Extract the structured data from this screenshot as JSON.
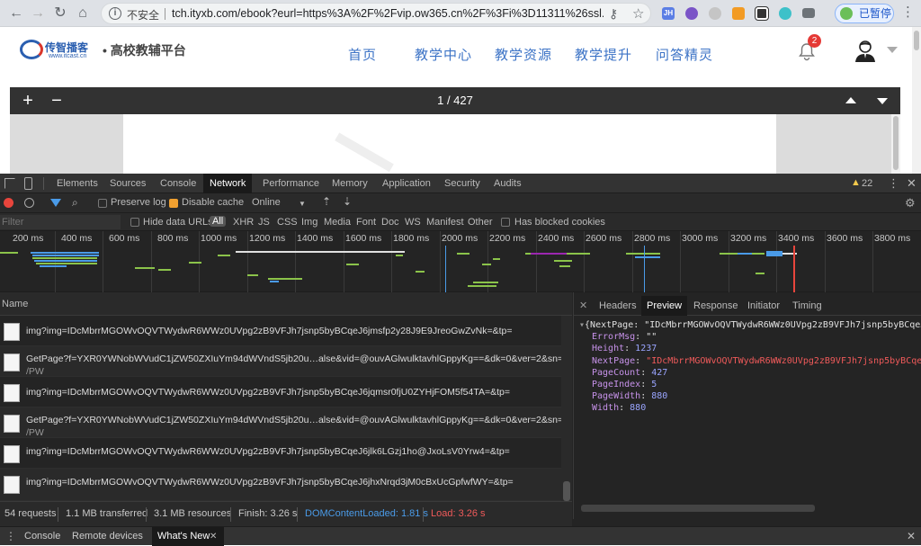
{
  "browser": {
    "insecure_label": "不安全",
    "url": "tch.ityxb.com/ebook?eurl=https%3A%2F%2Fvip.ow365.cn%2F%3Fi%3D11311%26ssl...",
    "profile_label": "已暂停",
    "extensions": [
      "JH",
      "globe",
      "gear",
      "folder",
      "qr",
      "chrome",
      "monitor"
    ]
  },
  "site": {
    "brand": "传智播客",
    "brand_sub": "www.itcast.cn",
    "platform": "高校教辅平台",
    "nav": [
      "首页",
      "教学中心",
      "教学资源",
      "教学提升",
      "问答精灵"
    ],
    "notification_count": "2"
  },
  "reader": {
    "zoom_in": "+",
    "zoom_out": "−",
    "page_indicator": "1 / 427"
  },
  "devtools": {
    "tabs": [
      "Elements",
      "Sources",
      "Console",
      "Network",
      "Performance",
      "Memory",
      "Application",
      "Security",
      "Audits"
    ],
    "active_tab": "Network",
    "warning_count": "22",
    "toolbar": {
      "preserve_log": "Preserve log",
      "disable_cache": "Disable cache",
      "throttle": "Online"
    },
    "filter": {
      "placeholder": "Filter",
      "hide_data_urls": "Hide data URLs",
      "types": [
        "All",
        "XHR",
        "JS",
        "CSS",
        "Img",
        "Media",
        "Font",
        "Doc",
        "WS",
        "Manifest",
        "Other"
      ],
      "blocked_cookies": "Has blocked cookies"
    },
    "timeline_ticks": [
      "200 ms",
      "400 ms",
      "600 ms",
      "800 ms",
      "1000 ms",
      "1200 ms",
      "1400 ms",
      "1600 ms",
      "1800 ms",
      "2000 ms",
      "2200 ms",
      "2400 ms",
      "2600 ms",
      "2800 ms",
      "3000 ms",
      "3200 ms",
      "3400 ms",
      "3600 ms",
      "3800 ms"
    ],
    "name_header": "Name",
    "requests": [
      {
        "line1": "img?img=IDcMbrrMGOWvOQVTWydwR6WWz0UVpg2zB9VFJh7jsnp5byBCqeJ6jmsfp2y28J9E9JreoGwZvNk=&tp=",
        "line2": ""
      },
      {
        "line1": "GetPage?f=YXR0YWNobWVudC1jZW50ZXIuYm94dWVndS5jb20u…alse&vid=@ouvAGlwulktavhlGppyKg==&dk=0&ver=2&sn=3",
        "line2": "/PW"
      },
      {
        "line1": "img?img=IDcMbrrMGOWvOQVTWydwR6WWz0UVpg2zB9VFJh7jsnp5byBCqeJ6jqmsr0fjU0ZYHjFOM5f54TA=&tp=",
        "line2": ""
      },
      {
        "line1": "GetPage?f=YXR0YWNobWVudC1jZW50ZXIuYm94dWVndS5jb20u…alse&vid=@ouvAGlwulktavhlGppyKg==&dk=0&ver=2&sn=4",
        "line2": "/PW"
      },
      {
        "line1": "img?img=IDcMbrrMGOWvOQVTWydwR6WWz0UVpg2zB9VFJh7jsnp5byBCqeJ6jlk6LGzj1ho@JxoLsV0Yrw4=&tp=",
        "line2": ""
      },
      {
        "line1": "img?img=IDcMbrrMGOWvOQVTWydwR6WWz0UVpg2zB9VFJh7jsnp5byBCqeJ6jhxNrqd3jM0cBxUcGpfwfWY=&tp=",
        "line2": ""
      }
    ],
    "detail_tabs": [
      "Headers",
      "Preview",
      "Response",
      "Initiator",
      "Timing"
    ],
    "active_detail_tab": "Preview",
    "preview": {
      "head": "{NextPage: \"IDcMbrrMGOWvOQVTWydwR6WWz0UVpg2zB9VFJh7jsnp5byBCqeJ",
      "fields": [
        {
          "key": "ErrorMsg",
          "value": "\"\"",
          "kind": "s"
        },
        {
          "key": "Height",
          "value": "1237",
          "kind": "n"
        },
        {
          "key": "NextPage",
          "value": "\"IDcMbrrMGOWvOQVTWydwR6WWz0UVpg2zB9VFJh7jsnp5byBCqe",
          "kind": "red"
        },
        {
          "key": "PageCount",
          "value": "427",
          "kind": "n"
        },
        {
          "key": "PageIndex",
          "value": "5",
          "kind": "n"
        },
        {
          "key": "PageWidth",
          "value": "880",
          "kind": "n"
        },
        {
          "key": "Width",
          "value": "880",
          "kind": "n"
        }
      ]
    },
    "status": {
      "requests": "54 requests",
      "transferred": "1.1 MB transferred",
      "resources": "3.1 MB resources",
      "finish": "Finish: 3.26 s",
      "dom_loaded": "DOMContentLoaded: 1.81 s",
      "load": "Load: 3.26 s"
    },
    "drawer_tabs": [
      "Console",
      "Remote devices",
      "What's New"
    ],
    "active_drawer_tab": "What's New"
  },
  "colors": {
    "dom_loaded": "#4a9be8",
    "load": "#f05a5a",
    "site_link": "#3c73c6"
  }
}
